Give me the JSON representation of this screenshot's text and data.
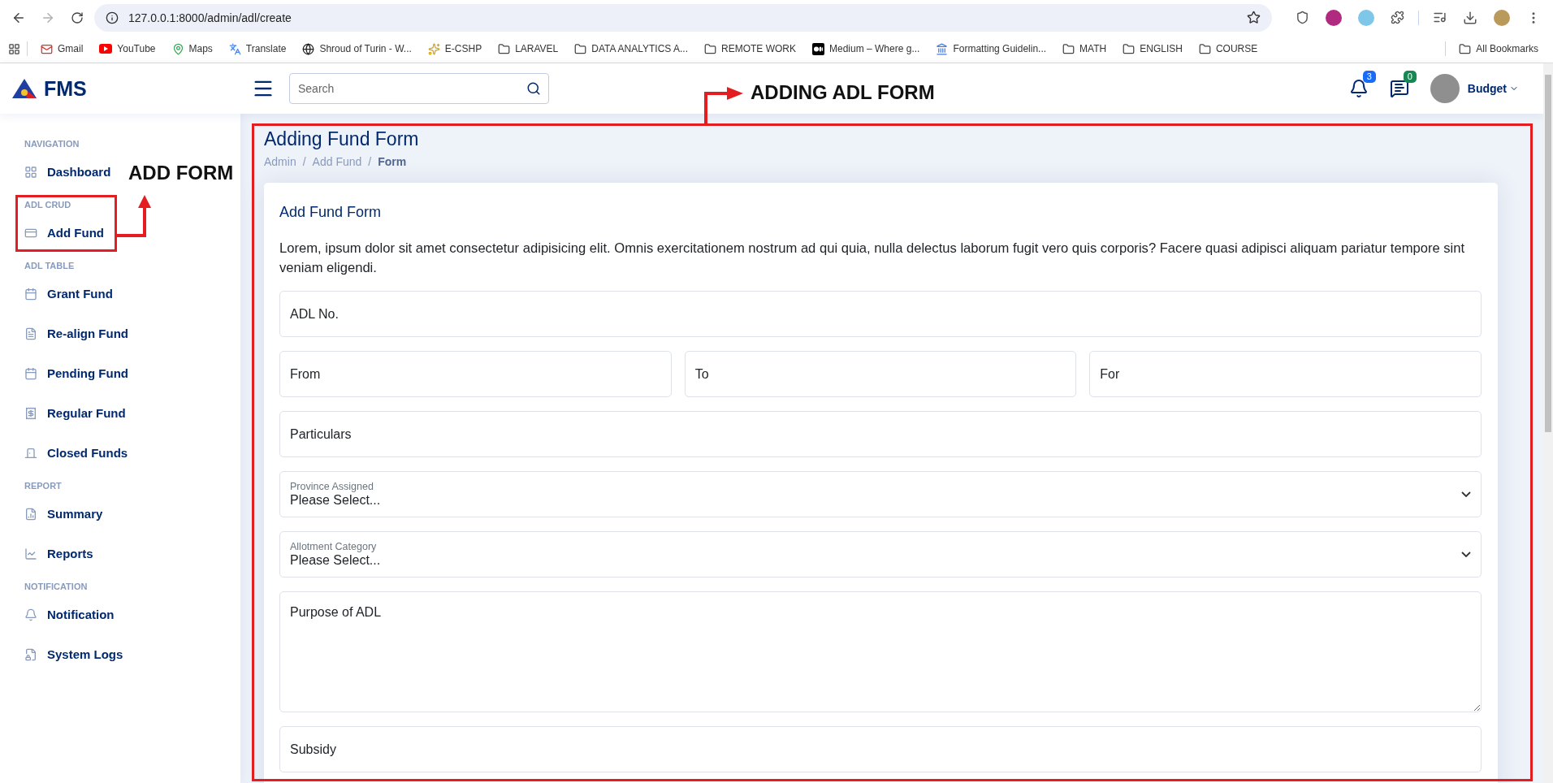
{
  "browser": {
    "url": "127.0.0.1:8000/admin/adl/create",
    "bookmarks": [
      {
        "label": "Gmail",
        "kind": "gmail"
      },
      {
        "label": "YouTube",
        "kind": "youtube"
      },
      {
        "label": "Maps",
        "kind": "maps"
      },
      {
        "label": "Translate",
        "kind": "translate"
      },
      {
        "label": "Shroud of Turin - W...",
        "kind": "wiki"
      },
      {
        "label": "E-CSHP",
        "kind": "site"
      },
      {
        "label": "LARAVEL",
        "kind": "folder"
      },
      {
        "label": "DATA ANALYTICS A...",
        "kind": "folder"
      },
      {
        "label": "REMOTE WORK",
        "kind": "folder"
      },
      {
        "label": "Medium – Where g...",
        "kind": "medium"
      },
      {
        "label": "Formatting Guidelin...",
        "kind": "doc"
      },
      {
        "label": "MATH",
        "kind": "folder"
      },
      {
        "label": "ENGLISH",
        "kind": "folder"
      },
      {
        "label": "COURSE",
        "kind": "folder"
      }
    ],
    "all_bookmarks": "All Bookmarks"
  },
  "header": {
    "logo": "FMS",
    "search": {
      "placeholder": "Search"
    },
    "notifications": "3",
    "messages": "0",
    "user": "Budget"
  },
  "sidebar": {
    "sections": [
      {
        "title": "NAVIGATION",
        "items": [
          {
            "label": "Dashboard",
            "kind": "grid"
          }
        ]
      },
      {
        "title": "ADL CRUD",
        "items": [
          {
            "label": "Add Fund",
            "kind": "card"
          }
        ]
      },
      {
        "title": "ADL TABLE",
        "items": [
          {
            "label": "Grant Fund",
            "kind": "calendar"
          },
          {
            "label": "Re-align Fund",
            "kind": "document"
          },
          {
            "label": "Pending Fund",
            "kind": "calendar"
          },
          {
            "label": "Regular Fund",
            "kind": "receipt"
          },
          {
            "label": "Closed Funds",
            "kind": "door"
          }
        ]
      },
      {
        "title": "REPORT",
        "items": [
          {
            "label": "Summary",
            "kind": "bar-chart"
          },
          {
            "label": "Reports",
            "kind": "line-chart"
          }
        ]
      },
      {
        "title": "NOTIFICATION",
        "items": [
          {
            "label": "Notification",
            "kind": "bell"
          },
          {
            "label": "System Logs",
            "kind": "lock-file"
          }
        ]
      }
    ]
  },
  "page": {
    "title": "Adding Fund Form",
    "breadcrumb_separator": "/",
    "breadcrumbs": [
      {
        "label": "Admin",
        "current": false
      },
      {
        "label": "Add Fund",
        "current": false
      },
      {
        "label": "Form",
        "current": true
      }
    ],
    "card": {
      "title": "Add Fund Form",
      "description": "Lorem, ipsum dolor sit amet consectetur adipisicing elit. Omnis exercitationem nostrum ad qui quia, nulla delectus laborum fugit vero quis corporis? Facere quasi adipisci aliquam pariatur tempore sint veniam eligendi.",
      "rows": [
        [
          {
            "kind": "text",
            "placeholder": "ADL No."
          }
        ],
        [
          {
            "kind": "text",
            "placeholder": "From"
          },
          {
            "kind": "text",
            "placeholder": "To"
          },
          {
            "kind": "text",
            "placeholder": "For"
          }
        ],
        [
          {
            "kind": "text",
            "placeholder": "Particulars"
          }
        ],
        [
          {
            "kind": "select",
            "label": "Province Assigned",
            "value": "Please Select..."
          }
        ],
        [
          {
            "kind": "select",
            "label": "Allotment Category",
            "value": "Please Select..."
          }
        ],
        [
          {
            "kind": "textarea",
            "placeholder": "Purpose of ADL"
          }
        ],
        [
          {
            "kind": "text",
            "placeholder": "Subsidy"
          }
        ]
      ]
    }
  },
  "annotations": [
    {
      "kind": "sidebar",
      "text": "ADD FORM"
    },
    {
      "kind": "content",
      "text": "ADDING ADL FORM"
    }
  ]
}
